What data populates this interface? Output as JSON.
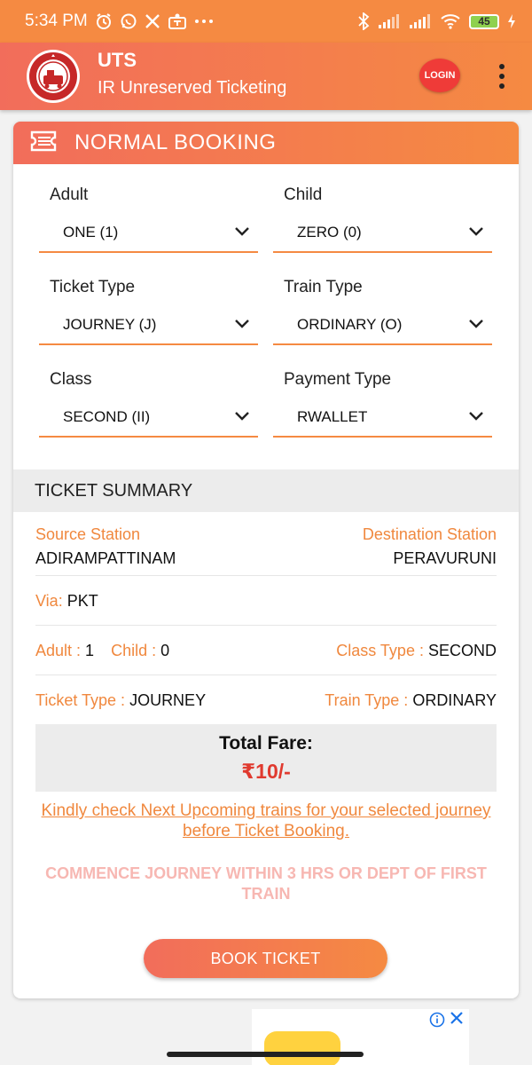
{
  "status_bar": {
    "time": "5:34 PM",
    "left_icons": [
      "alarm-icon",
      "whatsapp-icon",
      "x-icon",
      "teams-icon",
      "more-icon"
    ],
    "right_icons": [
      "bluetooth-icon",
      "signal-icon",
      "signal-icon",
      "wifi-icon",
      "battery-icon",
      "charging-icon"
    ],
    "battery": "45"
  },
  "app_bar": {
    "title": "UTS",
    "subtitle": "IR Unreserved Ticketing",
    "login_label": "LOGIN",
    "logo_icon": "indian-railways-logo"
  },
  "booking": {
    "header_title": "NORMAL BOOKING",
    "header_icon": "ticket-icon",
    "fields": {
      "adult": {
        "label": "Adult",
        "value": "ONE (1)"
      },
      "child": {
        "label": "Child",
        "value": "ZERO (0)"
      },
      "ticket_type": {
        "label": "Ticket Type",
        "value": "JOURNEY (J)"
      },
      "train_type": {
        "label": "Train Type",
        "value": "ORDINARY (O)"
      },
      "class": {
        "label": "Class",
        "value": "SECOND (II)"
      },
      "payment_type": {
        "label": "Payment Type",
        "value": "RWALLET"
      }
    }
  },
  "summary": {
    "title": "TICKET SUMMARY",
    "source_label": "Source Station",
    "source_value": "ADIRAMPATTINAM",
    "destination_label": "Destination Station",
    "destination_value": "PERAVURUNI",
    "via_label": "Via:",
    "via_value": "PKT",
    "adult_label": "Adult :",
    "adult_value": "1",
    "child_label": "Child :",
    "child_value": "0",
    "class_type_label": "Class Type :",
    "class_type_value": "SECOND",
    "ticket_type_label": "Ticket Type :",
    "ticket_type_value": "JOURNEY",
    "train_type_label": "Train Type :",
    "train_type_value": "ORDINARY",
    "total_fare_label": "Total Fare:",
    "total_fare_value": "₹10/-",
    "notice_link": "Kindly check Next Upcoming trains for your selected journey before Ticket Booking.",
    "commence_notice": "COMMENCE JOURNEY WITHIN 3 HRS OR DEPT OF FIRST TRAIN",
    "book_button": "BOOK TICKET"
  },
  "ad": {
    "info_icon": "info-icon",
    "close_icon": "close-icon"
  },
  "colors": {
    "accent": "#f58a42",
    "accent_start": "#f26d5b",
    "label_orange": "#f0883e",
    "fare_red": "#e03a2f",
    "login_red": "#ef3b38"
  }
}
